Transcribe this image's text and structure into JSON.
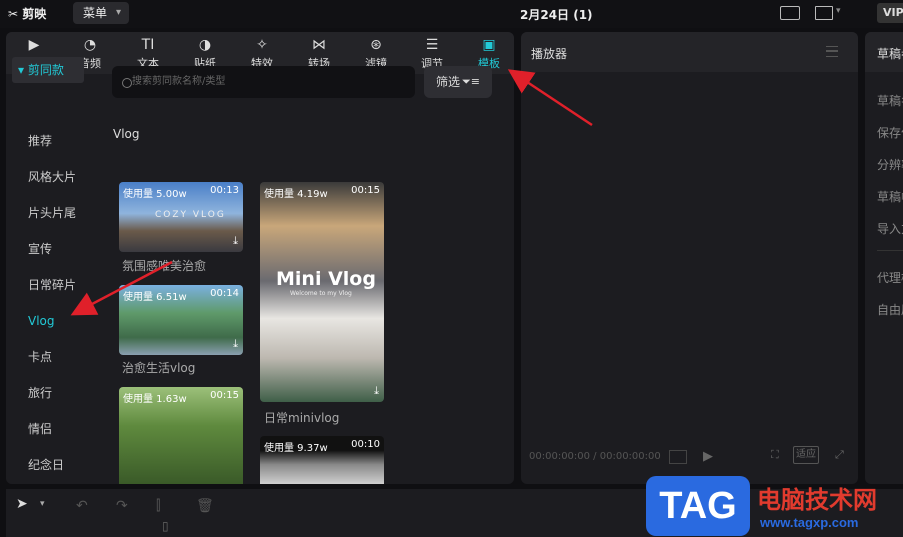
{
  "app": {
    "name": "剪映",
    "menu_label": "菜单",
    "doc_title": "2月24日 (1)",
    "pro_badge": "VIP"
  },
  "tabs": [
    {
      "label": "媒体",
      "icon": "media-icon"
    },
    {
      "label": "音频",
      "icon": "audio-icon"
    },
    {
      "label": "文本",
      "icon": "text-icon"
    },
    {
      "label": "贴纸",
      "icon": "sticker-icon"
    },
    {
      "label": "特效",
      "icon": "effects-icon"
    },
    {
      "label": "转场",
      "icon": "transition-icon"
    },
    {
      "label": "滤镜",
      "icon": "filter-icon"
    },
    {
      "label": "调节",
      "icon": "adjust-icon"
    },
    {
      "label": "模板",
      "icon": "template-icon",
      "active": true
    }
  ],
  "sidebar": {
    "header": "剪同款",
    "items": [
      "推荐",
      "风格大片",
      "片头片尾",
      "宣传",
      "日常碎片",
      "Vlog",
      "卡点",
      "旅行",
      "情侣",
      "纪念日"
    ],
    "active_item": "Vlog"
  },
  "search": {
    "placeholder": "搜索剪同款名称/类型"
  },
  "filter": {
    "label": "筛选"
  },
  "section": {
    "title": "Vlog"
  },
  "templates": [
    {
      "usage": "使用量 5.00w",
      "duration": "00:13",
      "title": "氛围感唯美治愈",
      "thumb_text": "COZY VLOG"
    },
    {
      "usage": "使用量 6.51w",
      "duration": "00:14",
      "title": "治愈生活vlog"
    },
    {
      "usage": "使用量 1.63w",
      "duration": "00:15",
      "title": ""
    },
    {
      "usage": "使用量 4.19w",
      "duration": "00:15",
      "title": "日常minivlog",
      "thumb_text": "Mini Vlog",
      "thumb_sub": "Welcome to my Vlog"
    },
    {
      "usage": "使用量 9.37w",
      "duration": "00:10",
      "title": ""
    }
  ],
  "player": {
    "title": "播放器",
    "timecode": "00:00:00:00 / 00:00:00:00",
    "ratio_label": "适应"
  },
  "draft": {
    "title": "草稿参数",
    "items": [
      "草稿名称",
      "保存位置",
      "分辨率",
      "草稿帧率",
      "导入方式",
      "代理模式",
      "自由层级"
    ]
  },
  "watermark": {
    "tag": "TAG",
    "site_name": "电脑技术网",
    "url": "www.tagxp.com"
  },
  "colors": {
    "accent": "#22c9d6",
    "arrow": "#e0202a"
  }
}
